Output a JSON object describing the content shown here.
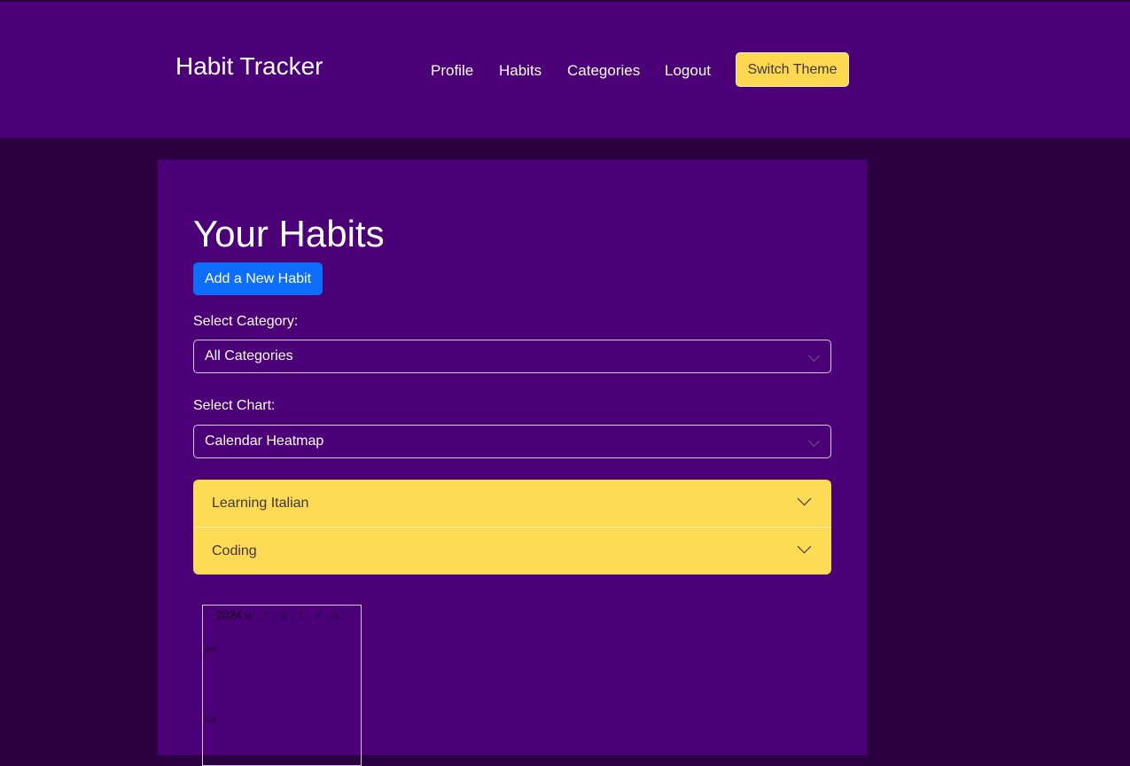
{
  "app": {
    "brand": "Habit Tracker"
  },
  "nav": {
    "items": [
      {
        "label": "Profile"
      },
      {
        "label": "Habits"
      },
      {
        "label": "Categories"
      },
      {
        "label": "Logout"
      }
    ],
    "theme_button": "Switch Theme"
  },
  "main": {
    "title": "Your Habits",
    "add_button": "Add a New Habit",
    "category_label": "Select Category:",
    "category_value": "All Categories",
    "chart_label": "Select Chart:",
    "chart_value": "Calendar Heatmap",
    "habits": [
      {
        "label": "Learning Italian"
      },
      {
        "label": "Coding"
      }
    ]
  },
  "heatmap": {
    "year": "2024",
    "weekdays": [
      "S",
      "M",
      "T",
      "W",
      "T",
      "F",
      "S"
    ],
    "months": [
      "Jan",
      "Feb"
    ]
  },
  "colors": {
    "navbar": "#4b0078",
    "background": "#2a0040",
    "accent_yellow": "#ffda55",
    "primary_blue": "#0d6efd"
  }
}
